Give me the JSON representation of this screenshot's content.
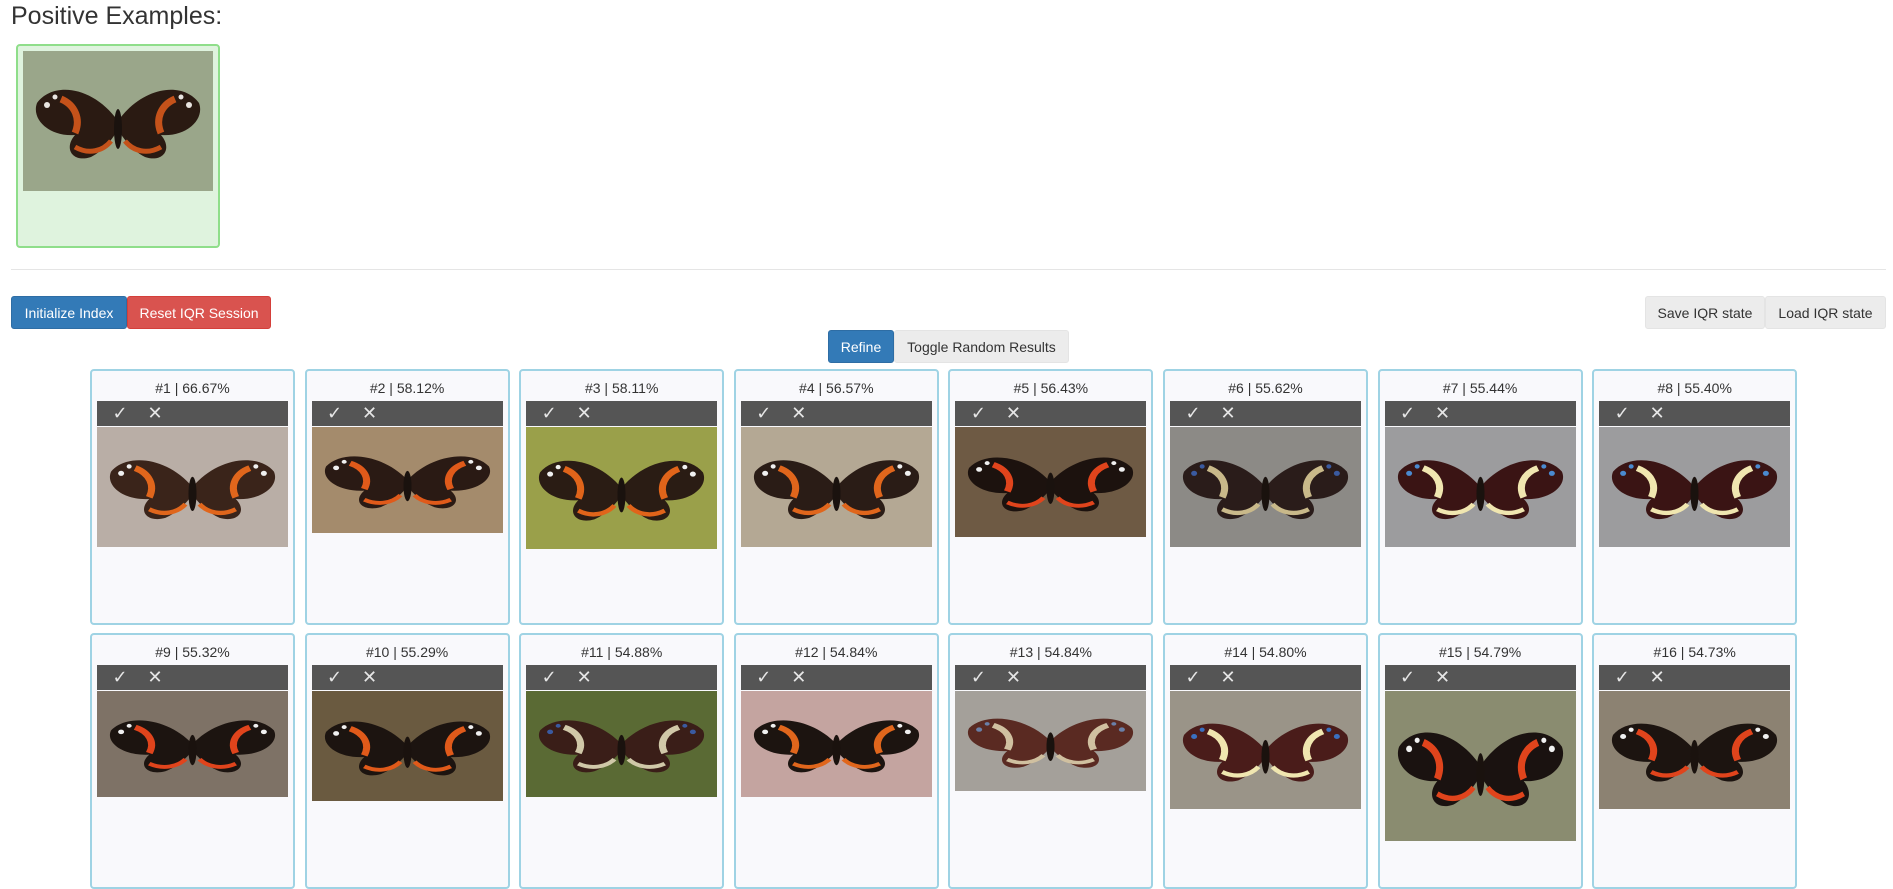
{
  "positive_examples": {
    "heading": "Positive Examples:",
    "items": [
      {
        "bg": "#9aa68a",
        "body": "#2a1a12",
        "band": "#c5521a",
        "spot": "#e8e4e0"
      }
    ]
  },
  "toolbar": {
    "initialize_label": "Initialize Index",
    "reset_label": "Reset IQR Session",
    "save_label": "Save IQR state",
    "load_label": "Load IQR state",
    "refine_label": "Refine",
    "toggle_random_label": "Toggle Random Results"
  },
  "icons": {
    "accept": "check-icon",
    "reject": "close-icon"
  },
  "results": [
    {
      "label": "#1 | 66.67%",
      "bg": "#b9aea6",
      "body": "#3a241a",
      "band": "#e0661c",
      "spot": "#f0f0f0"
    },
    {
      "label": "#2 | 58.12%",
      "bg": "#a48b6c",
      "body": "#2a1a14",
      "band": "#e05a1a",
      "spot": "#f0f0f0"
    },
    {
      "label": "#3 | 58.11%",
      "bg": "#9aa04a",
      "body": "#2a1c14",
      "band": "#e0641a",
      "spot": "#f0f0f0"
    },
    {
      "label": "#4 | 56.57%",
      "bg": "#b4a894",
      "body": "#2a1c16",
      "band": "#e0661c",
      "spot": "#f0f0f0"
    },
    {
      "label": "#5 | 56.43%",
      "bg": "#6e5a44",
      "body": "#1c120e",
      "band": "#e0441c",
      "spot": "#f0f0f0"
    },
    {
      "label": "#6 | 55.62%",
      "bg": "#8c8a86",
      "body": "#2a1c1a",
      "band": "#c9b98a",
      "spot": "#3a5aa0"
    },
    {
      "label": "#7 | 55.44%",
      "bg": "#9c9c9e",
      "body": "#3a1414",
      "band": "#f0e6b0",
      "spot": "#4a8ad0"
    },
    {
      "label": "#8 | 55.40%",
      "bg": "#9c9c9e",
      "body": "#3a1414",
      "band": "#f0e6b0",
      "spot": "#4a8ad0"
    },
    {
      "label": "#9 | 55.32%",
      "bg": "#7e7266",
      "body": "#1c1410",
      "band": "#e0441c",
      "spot": "#f0f0f0"
    },
    {
      "label": "#10 | 55.29%",
      "bg": "#6a5a40",
      "body": "#1c1410",
      "band": "#e05a1a",
      "spot": "#f0f0f0"
    },
    {
      "label": "#11 | 54.88%",
      "bg": "#5a6a34",
      "body": "#3a1e18",
      "band": "#d0c8a8",
      "spot": "#3a5aa0"
    },
    {
      "label": "#12 | 54.84%",
      "bg": "#c4a4a0",
      "body": "#1c1410",
      "band": "#e0661c",
      "spot": "#f0f0f0"
    },
    {
      "label": "#13 | 54.84%",
      "bg": "#a4a09a",
      "body": "#5a2a22",
      "band": "#d0c0a0",
      "spot": "#6a80a8"
    },
    {
      "label": "#14 | 54.80%",
      "bg": "#9a9488",
      "body": "#4a1c1a",
      "band": "#f0e6b0",
      "spot": "#3a70c0"
    },
    {
      "label": "#15 | 54.79%",
      "bg": "#8a8c70",
      "body": "#1a1210",
      "band": "#e0441c",
      "spot": "#f0f0f0"
    },
    {
      "label": "#16 | 54.73%",
      "bg": "#8c8272",
      "body": "#1c1410",
      "band": "#e0441c",
      "spot": "#f0f0f0"
    }
  ]
}
